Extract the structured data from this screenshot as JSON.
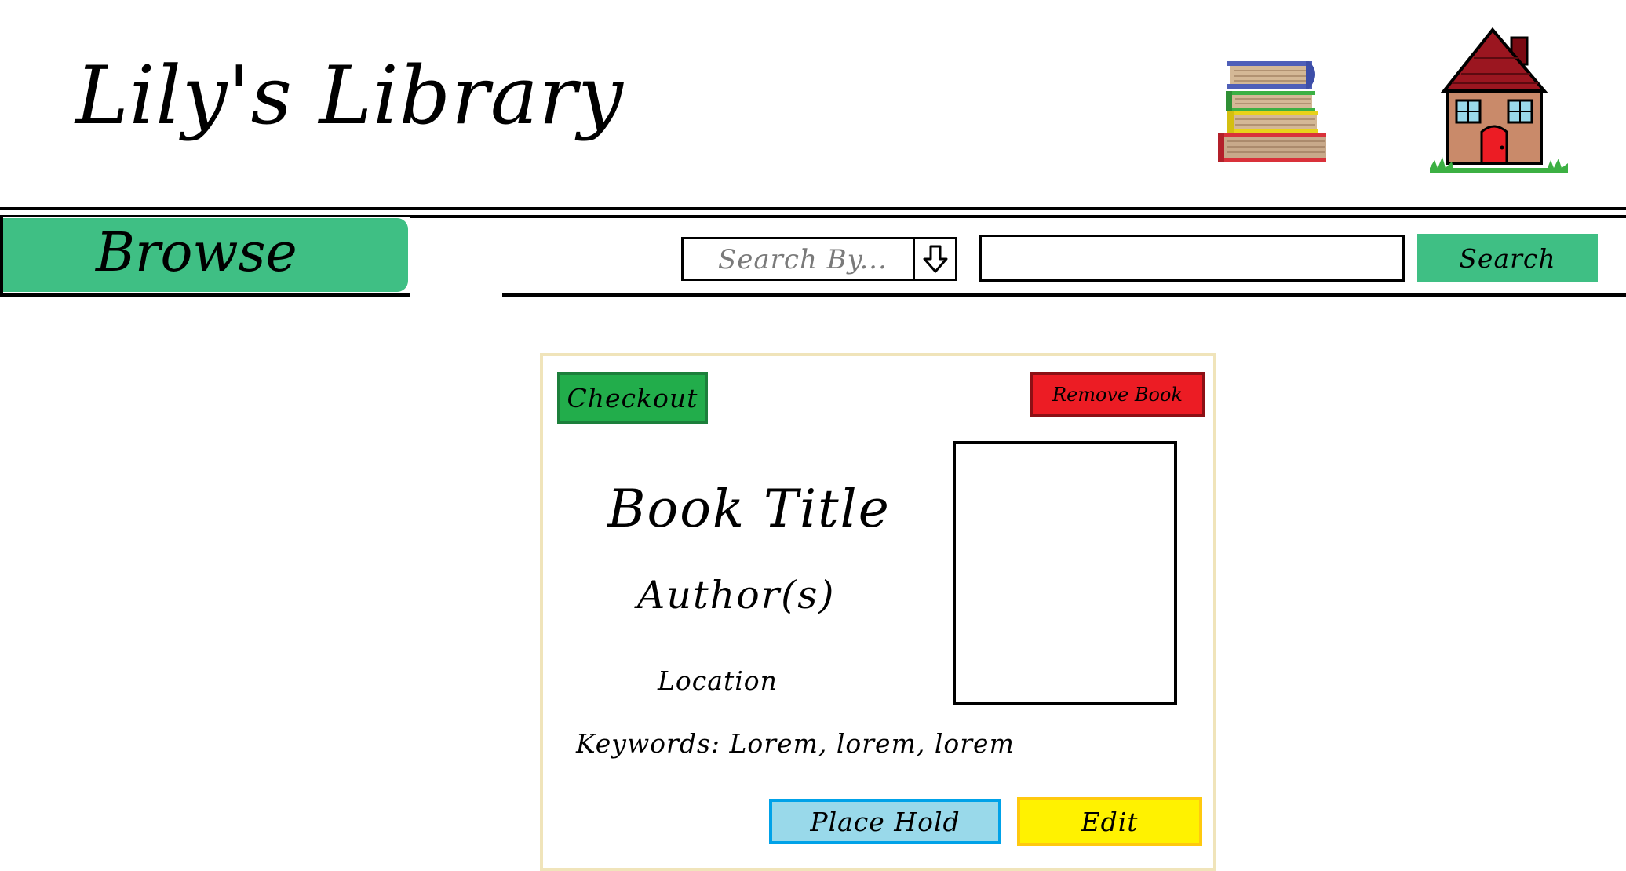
{
  "header": {
    "site_title": "Lily's Library",
    "books_icon": "stacked-books-icon",
    "home_icon": "house-icon"
  },
  "nav": {
    "browse_label": "Browse",
    "search_by_placeholder": "Search By...",
    "search_query": "",
    "search_button_label": "Search"
  },
  "book": {
    "checkout_label": "Checkout",
    "remove_label": "Remove Book",
    "title": "Book Title",
    "authors": "Author(s)",
    "location": "Location",
    "keywords": "Keywords: Lorem, lorem, lorem",
    "place_hold_label": "Place Hold",
    "edit_label": "Edit"
  },
  "colors": {
    "accent_green": "#3fbf84",
    "checkout_green": "#22ad4b",
    "remove_red": "#ec1c24",
    "hold_blue": "#99d9ea",
    "edit_yellow": "#fff200",
    "card_border": "#f0e4ba"
  }
}
